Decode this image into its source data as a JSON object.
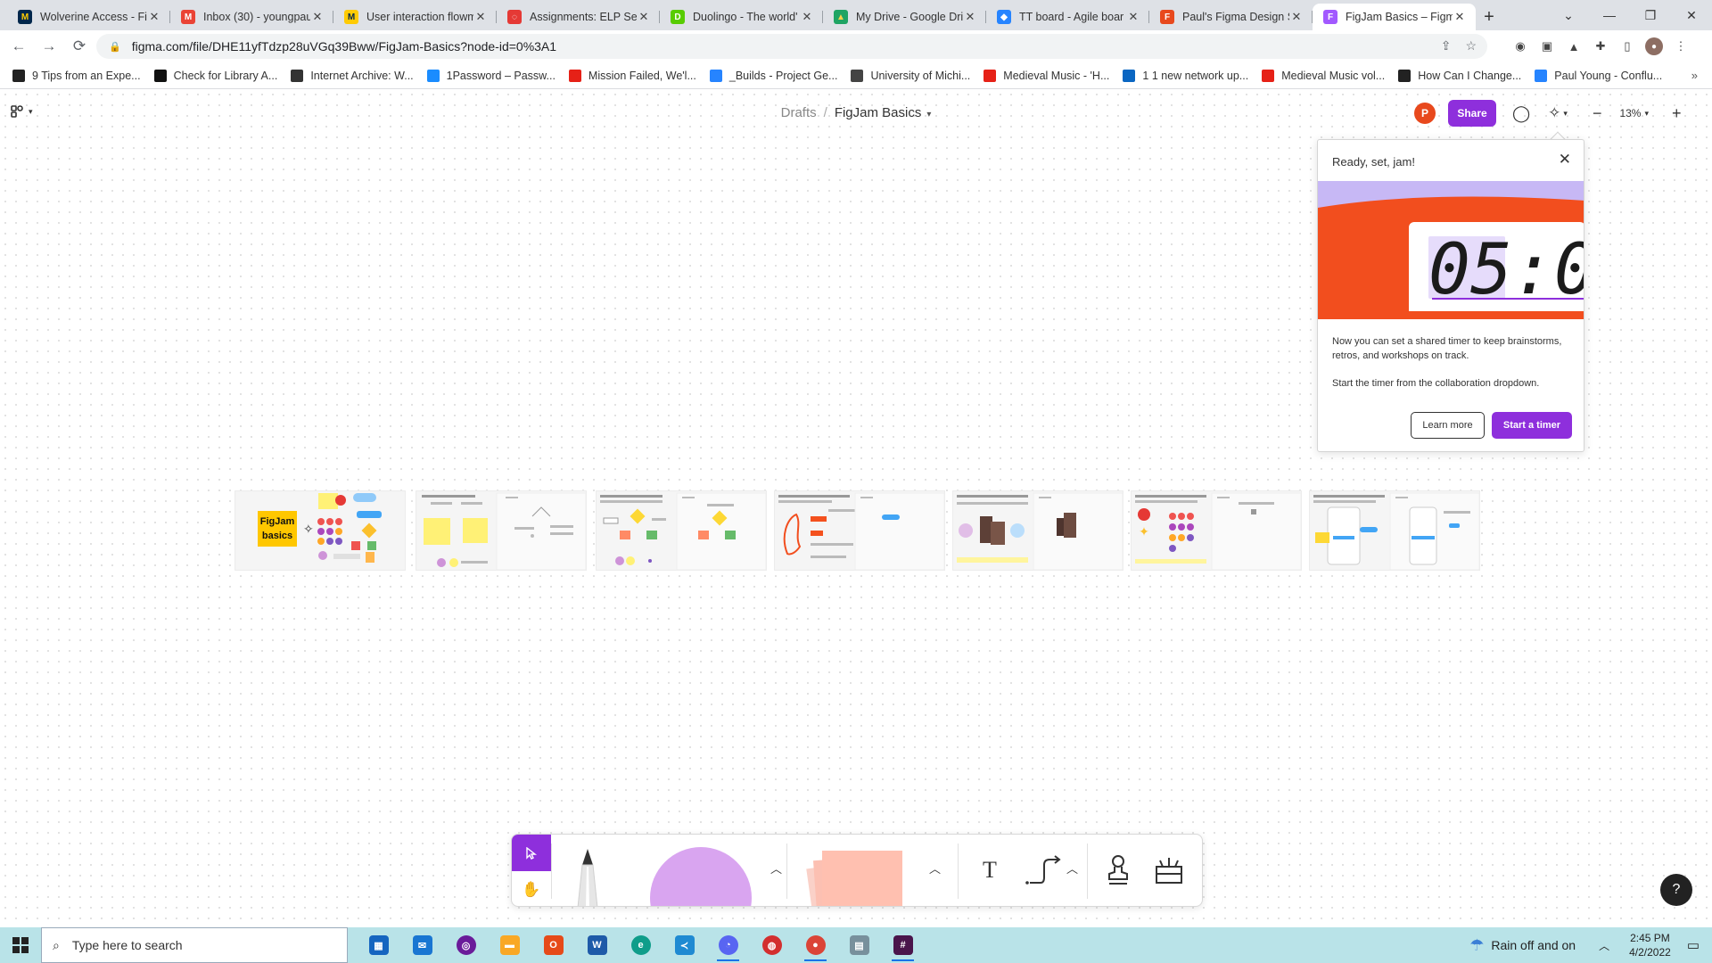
{
  "browser": {
    "tabs": [
      {
        "title": "Wolverine Access - Fin",
        "fav_letter": "M",
        "fav_color": "#00274c",
        "fav_text": "#ffcb05"
      },
      {
        "title": "Inbox (30) - youngpau",
        "fav_letter": "M",
        "fav_color": "#ea4335",
        "fav_text": "#ffffff"
      },
      {
        "title": "User interaction flowm",
        "fav_letter": "M",
        "fav_color": "#ffcb05",
        "fav_text": "#00274c"
      },
      {
        "title": "Assignments: ELP Sem",
        "fav_letter": "◌",
        "fav_color": "#e53935",
        "fav_text": "#ffffff"
      },
      {
        "title": "Duolingo - The world'",
        "fav_letter": "D",
        "fav_color": "#58cc02",
        "fav_text": "#ffffff"
      },
      {
        "title": "My Drive - Google Dri",
        "fav_letter": "▲",
        "fav_color": "#1fa463",
        "fav_text": "#ffd04b"
      },
      {
        "title": "TT board - Agile boar",
        "fav_letter": "◆",
        "fav_color": "#2684ff",
        "fav_text": "#ffffff"
      },
      {
        "title": "Paul's Figma Design S",
        "fav_letter": "F",
        "fav_color": "#e8491d",
        "fav_text": "#ffffff"
      },
      {
        "title": "FigJam Basics – Figma",
        "fav_letter": "F",
        "fav_color": "#a259ff",
        "fav_text": "#ffffff"
      }
    ],
    "url": "figma.com/file/DHE11yfTdzp28uVGq39Bww/FigJam-Basics?node-id=0%3A1",
    "bookmarks": [
      {
        "label": "9 Tips from an Expe...",
        "color": "#222"
      },
      {
        "label": "Check for Library A...",
        "color": "#111"
      },
      {
        "label": "Internet Archive: W...",
        "color": "#333"
      },
      {
        "label": "1Password – Passw...",
        "color": "#1a8cff"
      },
      {
        "label": "Mission Failed, We'l...",
        "color": "#e62117"
      },
      {
        "label": "_Builds - Project Ge...",
        "color": "#2684ff"
      },
      {
        "label": "University of Michi...",
        "color": "#444"
      },
      {
        "label": "Medieval Music - 'H...",
        "color": "#e62117"
      },
      {
        "label": "1 1 new network up...",
        "color": "#0a66c2"
      },
      {
        "label": "Medieval Music vol...",
        "color": "#e62117"
      },
      {
        "label": "How Can I Change...",
        "color": "#222"
      },
      {
        "label": "Paul Young - Conflu...",
        "color": "#2684ff"
      }
    ]
  },
  "figma": {
    "breadcrumb_drafts": "Drafts",
    "breadcrumb_sep": "/",
    "file_name": "FigJam Basics",
    "user_initial": "P",
    "share_label": "Share",
    "zoom": "13%",
    "popover": {
      "title": "Ready, set, jam!",
      "timer_display": "05:0",
      "body1": "Now you can set a shared timer to keep brainstorms, retros, and workshops on track.",
      "body2": "Start the timer from the collaboration dropdown.",
      "learn_more": "Learn more",
      "start_timer": "Start a timer"
    },
    "thumbnail_title": "FigJam basics",
    "help": "?",
    "colors": {
      "purple": "#8e2fdc",
      "orange": "#f24e1e",
      "lilac": "#c7b8f5"
    }
  },
  "taskbar": {
    "search_placeholder": "Type here to search",
    "weather": "Rain off and on",
    "time": "2:45 PM",
    "date": "4/2/2022"
  }
}
